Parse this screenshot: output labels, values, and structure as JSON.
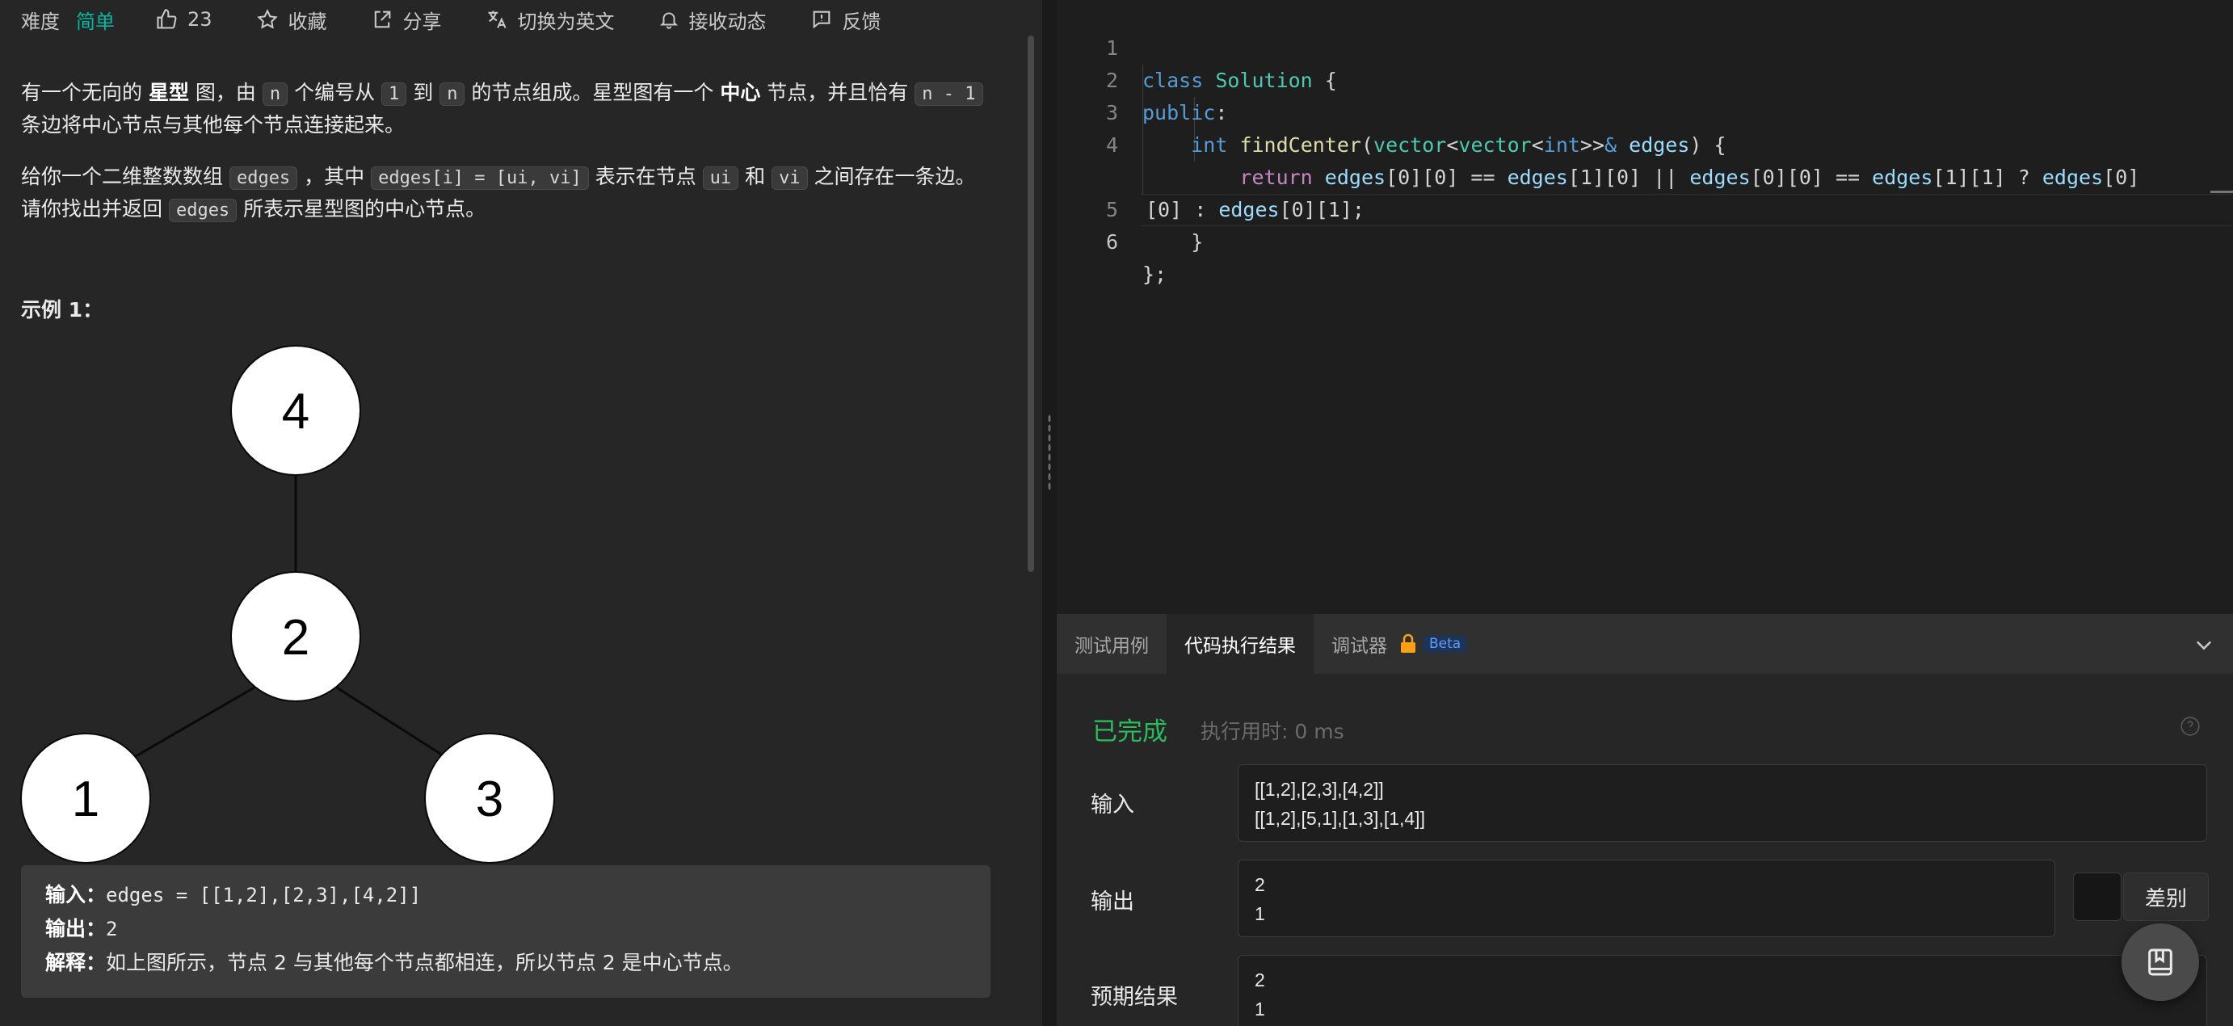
{
  "toolbar": {
    "difficulty_label": "难度",
    "difficulty_value": "简单",
    "likes": "23",
    "favorite": "收藏",
    "share": "分享",
    "switch_lang": "切换为英文",
    "subscribe": "接收动态",
    "feedback": "反馈"
  },
  "description": {
    "p1_a": "有一个无向的 ",
    "p1_b": "星型",
    "p1_c": " 图，由 ",
    "p1_n1": "n",
    "p1_d": " 个编号从 ",
    "p1_one": "1",
    "p1_e": " 到 ",
    "p1_n2": "n",
    "p1_f": " 的节点组成。星型图有一个 ",
    "p1_g": "中心",
    "p1_h": " 节点，并且恰有 ",
    "p1_nm1": "n - 1",
    "p1_i": " 条边将中心节点与其他每个节点连接起来。",
    "p2_a": "给你一个二维整数数组 ",
    "p2_edges": "edges",
    "p2_b": " ，其中 ",
    "p2_code": "edges[i] = [ui, vi]",
    "p2_c": " 表示在节点 ",
    "p2_ui": "ui",
    "p2_d": " 和 ",
    "p2_vi": "vi",
    "p2_e": " 之间存在一条边。请你找出并返回 ",
    "p2_edges2": "edges",
    "p2_f": " 所表示星型图的中心节点。"
  },
  "example": {
    "title": "示例 1：",
    "graph_nodes": [
      "4",
      "2",
      "1",
      "3"
    ],
    "input_label": "输入：",
    "input_value": "edges = [[1,2],[2,3],[4,2]]",
    "output_label": "输出：",
    "output_value": "2",
    "explain_label": "解释：",
    "explain_value": "如上图所示，节点 2 与其他每个节点都相连，所以节点 2 是中心节点。"
  },
  "editor": {
    "line_numbers": [
      "1",
      "2",
      "3",
      "4",
      "",
      "5",
      "6"
    ]
  },
  "panel": {
    "tab_testcase": "测试用例",
    "tab_result": "代码执行结果",
    "tab_debugger": "调试器",
    "beta": "Beta",
    "status": "已完成",
    "runtime": "执行用时: 0 ms",
    "input_label": "输入",
    "input_line1": "[[1,2],[2,3],[4,2]]",
    "input_line2": "[[1,2],[5,1],[1,3],[1,4]]",
    "output_label": "输出",
    "output_line1": "2",
    "output_line2": "1",
    "diff_label": "差别",
    "expected_label": "预期结果",
    "expected_line1": "2",
    "expected_line2": "1"
  },
  "colors": {
    "easy": "#00b8a3",
    "success": "#2cbb5d",
    "beta": "#5b9cff",
    "lock": "#ffa116"
  }
}
